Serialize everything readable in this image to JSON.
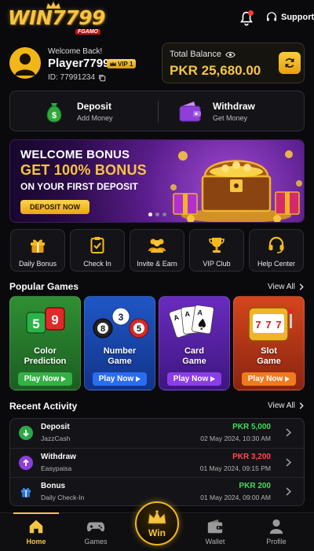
{
  "header": {
    "logo_text": "WIN7799",
    "logo_sub": "FGAMO",
    "support_label": "Support"
  },
  "profile": {
    "welcome": "Welcome Back!",
    "name": "Player7799",
    "vip": "VIP 1",
    "id": "ID: 77991234"
  },
  "balance": {
    "label": "Total Balance",
    "amount": "PKR 25,680.00"
  },
  "wallet_actions": {
    "deposit": {
      "title": "Deposit",
      "subtitle": "Add Money"
    },
    "withdraw": {
      "title": "Withdraw",
      "subtitle": "Get Money"
    }
  },
  "banner": {
    "line1": "WELCOME BONUS",
    "line2": "GET 100% BONUS",
    "line3": "ON YOUR FIRST DEPOSIT",
    "button": "DEPOSIT NOW"
  },
  "quick_actions": [
    {
      "label": "Daily Bonus",
      "icon": "gift-icon"
    },
    {
      "label": "Check In",
      "icon": "clipboard-check-icon"
    },
    {
      "label": "Invite & Earn",
      "icon": "users-icon"
    },
    {
      "label": "VIP Club",
      "icon": "trophy-icon"
    },
    {
      "label": "Help Center",
      "icon": "headset-icon"
    }
  ],
  "popular_games": {
    "title": "Popular Games",
    "view_all": "View All",
    "play_label": "Play Now",
    "games": [
      {
        "line1": "Color",
        "line2": "Prediction"
      },
      {
        "line1": "Number",
        "line2": "Game"
      },
      {
        "line1": "Card",
        "line2": "Game"
      },
      {
        "line1": "Slot",
        "line2": "Game"
      }
    ]
  },
  "recent_activity": {
    "title": "Recent Activity",
    "view_all": "View All",
    "items": [
      {
        "type": "Deposit",
        "method": "JazzCash",
        "amount": "PKR 5,000",
        "date": "02 May 2024, 10:30 AM",
        "amount_color": "#3ddc5a"
      },
      {
        "type": "Withdraw",
        "method": "Easypaisa",
        "amount": "PKR 3,200",
        "date": "01 May 2024, 09:15 PM",
        "amount_color": "#ff4a4a"
      },
      {
        "type": "Bonus",
        "method": "Daily Check-In",
        "amount": "PKR 200",
        "date": "01 May 2024, 09:00 AM",
        "amount_color": "#3ddc5a"
      }
    ]
  },
  "nav": {
    "home": "Home",
    "games": "Games",
    "win": "Win",
    "wallet": "Wallet",
    "profile": "Profile"
  },
  "colors": {
    "accent_gold": "#f5c542",
    "background": "#0a0a0d"
  }
}
